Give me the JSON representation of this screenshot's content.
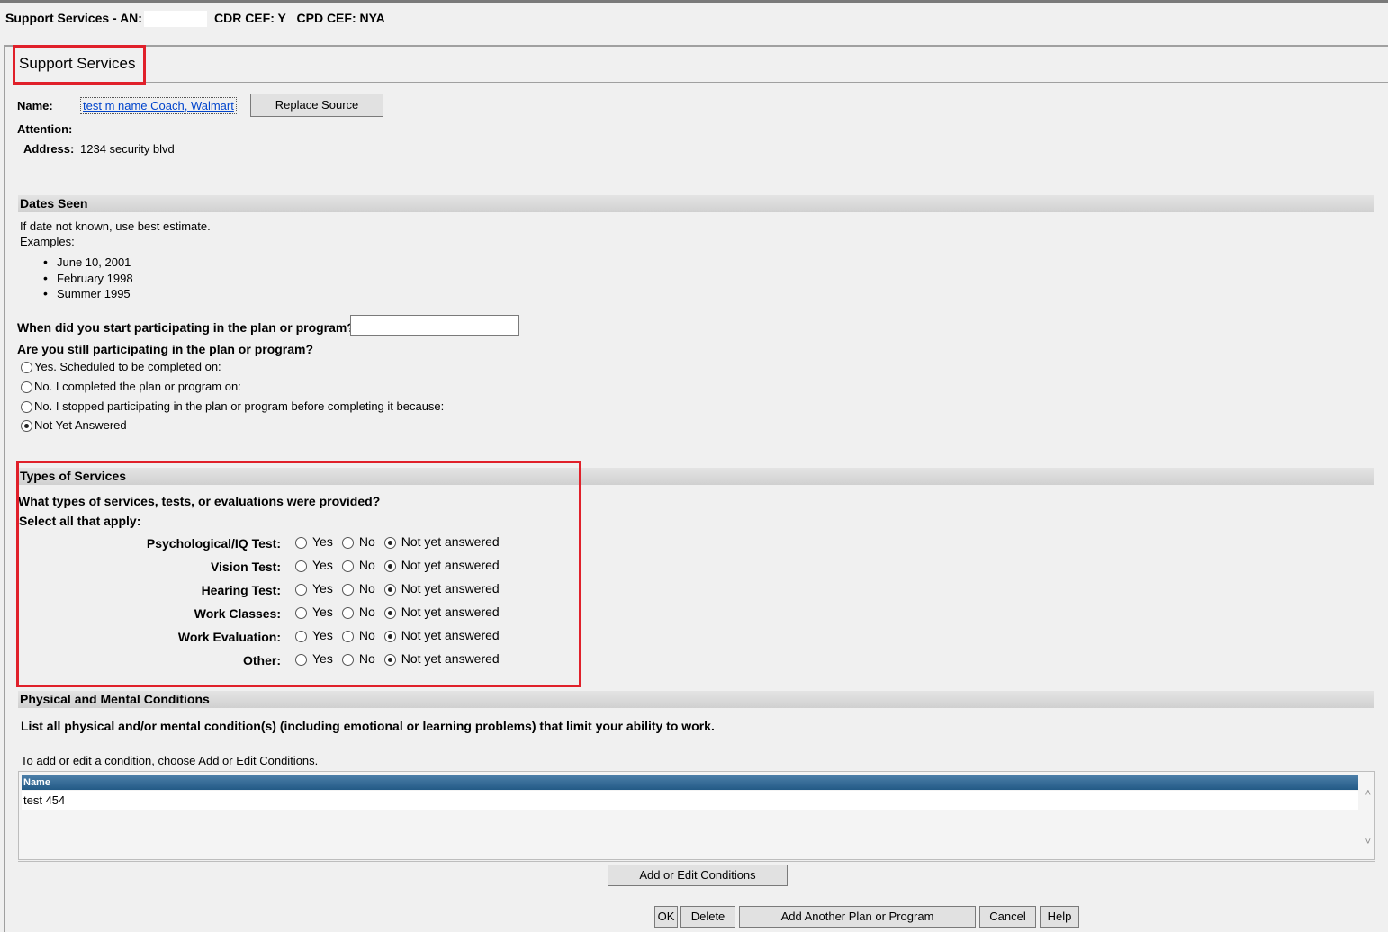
{
  "window": {
    "title_prefix": "Support Services - AN:",
    "cdr_label": "CDR CEF: Y",
    "cpd_label": "CPD CEF: NYA"
  },
  "page": {
    "title": "Support Services"
  },
  "source": {
    "name_label": "Name:",
    "name_value": "test m name Coach, Walmart",
    "replace_button": "Replace Source",
    "attention_label": "Attention:",
    "address_label": "Address:",
    "address_value": "1234 security blvd"
  },
  "dates_seen": {
    "header": "Dates Seen",
    "hint": "If date not known, use best estimate.",
    "examples_label": "Examples:",
    "examples": [
      "June 10, 2001",
      "February 1998",
      "Summer 1995"
    ],
    "start_question": "When did you start participating in the plan or program?",
    "start_value": "",
    "still_question": "Are you still participating in the plan or program?",
    "options": [
      "Yes. Scheduled to be completed on:",
      "No. I completed the plan or program on:",
      "No. I stopped participating in the plan or program before completing it because:",
      "Not Yet Answered"
    ],
    "selected_index": 3
  },
  "types_of_services": {
    "header": "Types of Services",
    "question": "What types of services, tests, or evaluations were provided?",
    "select_all": "Select all that apply:",
    "yes_label": "Yes",
    "no_label": "No",
    "nya_label": "Not yet answered",
    "rows": [
      {
        "label": "Psychological/IQ Test:",
        "selected": "nya"
      },
      {
        "label": "Vision Test:",
        "selected": "nya"
      },
      {
        "label": "Hearing Test:",
        "selected": "nya"
      },
      {
        "label": "Work Classes:",
        "selected": "nya"
      },
      {
        "label": "Work Evaluation:",
        "selected": "nya"
      },
      {
        "label": "Other:",
        "selected": "nya"
      }
    ]
  },
  "conditions": {
    "header": "Physical and Mental Conditions",
    "instruction": "List all physical and/or mental condition(s) (including emotional or learning problems) that limit your ability to work.",
    "hint": "To add or edit a condition, choose Add or Edit Conditions.",
    "table_header": "Name",
    "rows": [
      "test 454"
    ],
    "add_edit_button": "Add or Edit Conditions"
  },
  "footer_buttons": {
    "ok": "OK",
    "delete": "Delete",
    "add_another": "Add Another Plan or Program",
    "cancel": "Cancel",
    "help": "Help"
  }
}
